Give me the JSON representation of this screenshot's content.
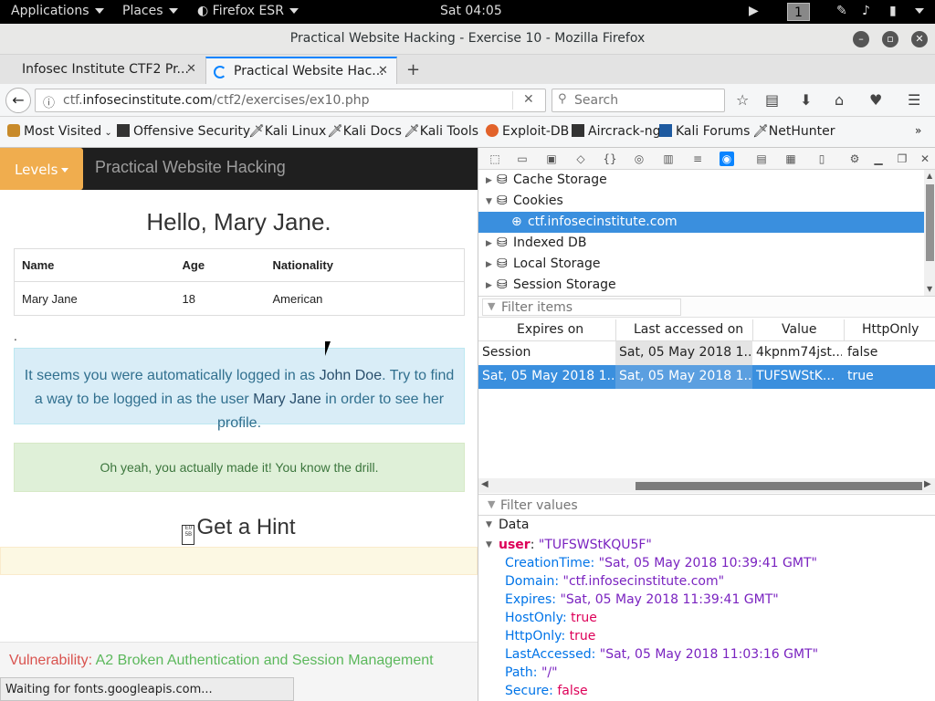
{
  "topbar": {
    "applications": "Applications",
    "places": "Places",
    "firefox_menu": "Firefox ESR",
    "clock": "Sat 04:05",
    "workspace": "1"
  },
  "window": {
    "title": "Practical Website Hacking - Exercise 10 - Mozilla Firefox"
  },
  "tabs": [
    {
      "label": "Infosec Institute CTF2 Pr..."
    },
    {
      "label": "Practical Website Hac..."
    }
  ],
  "nav": {
    "url_prefix": "ctf.",
    "url_domain": "infosecinstitute.com",
    "url_path": "/ctf2/exercises/ex10.php",
    "search_placeholder": "Search"
  },
  "bookmarks": [
    {
      "label": "Most Visited",
      "icon": "gear-icon"
    },
    {
      "label": "Offensive Security",
      "icon": "offsec-icon"
    },
    {
      "label": "Kali Linux",
      "icon": "kali-dragon-icon"
    },
    {
      "label": "Kali Docs",
      "icon": "kali-dragon-icon"
    },
    {
      "label": "Kali Tools",
      "icon": "kali-dragon-icon"
    },
    {
      "label": "Exploit-DB",
      "icon": "exploitdb-icon"
    },
    {
      "label": "Aircrack-ng",
      "icon": "aircrack-icon"
    },
    {
      "label": "Kali Forums",
      "icon": "kali-forums-icon"
    },
    {
      "label": "NetHunter",
      "icon": "kali-dragon-icon"
    }
  ],
  "page": {
    "levels_label": "Levels",
    "brand": "Practical Website Hacking",
    "greeting": "Hello, Mary Jane.",
    "table": {
      "headers": [
        "Name",
        "Age",
        "Nationality"
      ],
      "rows": [
        [
          "Mary Jane",
          "18",
          "American"
        ]
      ]
    },
    "dot": ".",
    "info_part1": "It seems you were automatically logged in as ",
    "info_user1": "John Doe",
    "info_part2": ". Try to find a way to be logged in as the user ",
    "info_user2": "Mary Jane",
    "info_part3": " in order to see her profile.",
    "success": "Oh yeah, you actually made it! You know the drill.",
    "hint_icon_text": "E0 5B",
    "hint": "Get a Hint",
    "vuln_label": "Vulnerability: ",
    "vuln_value": "A2 Broken Authentication and Session Management",
    "status": "Waiting for fonts.googleapis.com..."
  },
  "devtools": {
    "storage_tree": [
      {
        "label": "Cache Storage",
        "expanded": false
      },
      {
        "label": "Cookies",
        "expanded": true
      },
      {
        "label": "ctf.infosecinstitute.com",
        "child": true,
        "selected": true
      },
      {
        "label": "Indexed DB",
        "expanded": false
      },
      {
        "label": "Local Storage",
        "expanded": false
      },
      {
        "label": "Session Storage",
        "expanded": false
      }
    ],
    "filter_items_placeholder": "Filter items",
    "columns": [
      "Expires on",
      "Last accessed on",
      "Value",
      "HttpOnly"
    ],
    "rows": [
      {
        "expires": "Session",
        "last": "Sat, 05 May 2018 1...",
        "value": "4kpnm74jst...",
        "httponly": "false"
      },
      {
        "expires": "Sat, 05 May 2018 1...",
        "last": "Sat, 05 May 2018 1...",
        "value": "TUFSWStK...",
        "httponly": "true"
      }
    ],
    "filter_values_placeholder": "Filter values",
    "data_label": "Data",
    "cookie": {
      "key": "user",
      "value": "\"TUFSWStKQU5F\"",
      "props": [
        {
          "k": "CreationTime",
          "v": "\"Sat, 05 May 2018 10:39:41 GMT\"",
          "type": "str"
        },
        {
          "k": "Domain",
          "v": "\"ctf.infosecinstitute.com\"",
          "type": "str"
        },
        {
          "k": "Expires",
          "v": "\"Sat, 05 May 2018 11:39:41 GMT\"",
          "type": "str"
        },
        {
          "k": "HostOnly",
          "v": "true",
          "type": "bool"
        },
        {
          "k": "HttpOnly",
          "v": "true",
          "type": "bool"
        },
        {
          "k": "LastAccessed",
          "v": "\"Sat, 05 May 2018 11:03:16 GMT\"",
          "type": "str"
        },
        {
          "k": "Path",
          "v": "\"/\"",
          "type": "str"
        },
        {
          "k": "Secure",
          "v": "false",
          "type": "bool"
        }
      ]
    }
  },
  "colors": {
    "accent": "#0a84ff",
    "selection": "#3a8fde",
    "levels": "#f0ad4e"
  }
}
